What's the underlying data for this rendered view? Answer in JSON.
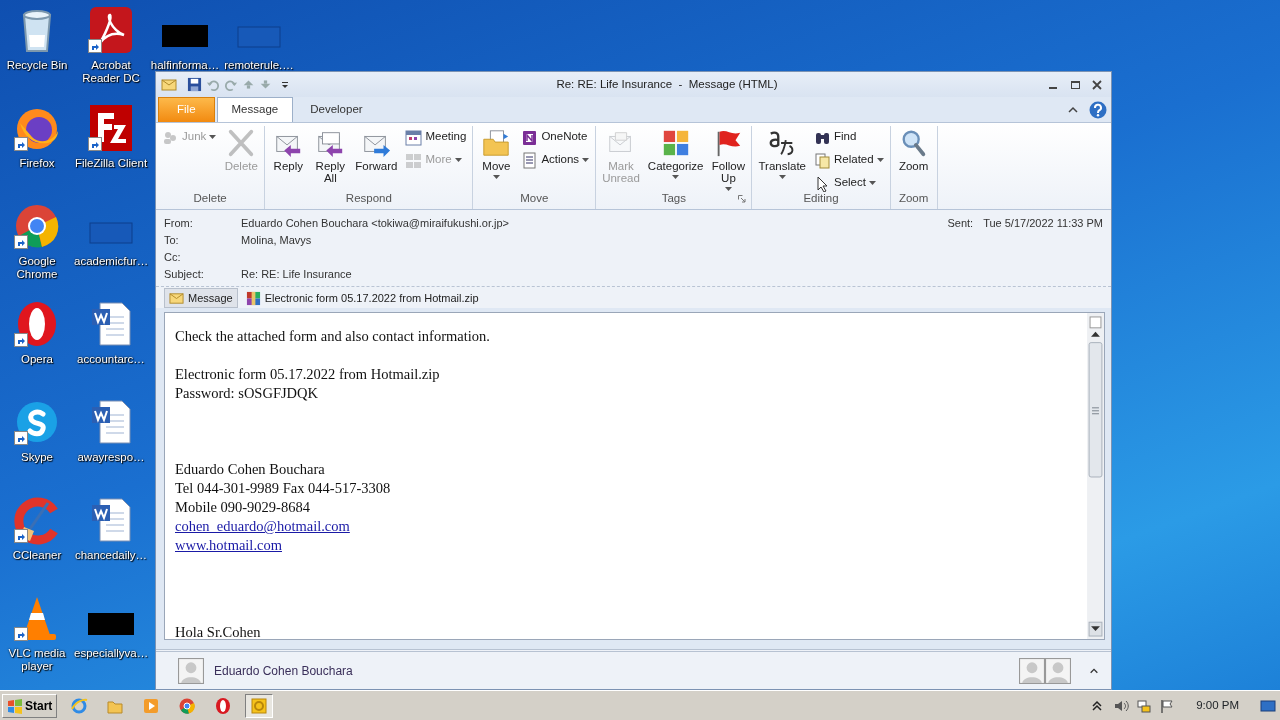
{
  "desktop": {
    "columns": [
      [
        {
          "label": "Recycle Bin",
          "shortcut": false
        },
        {
          "label": "Firefox",
          "shortcut": true
        },
        {
          "label": "Google Chrome",
          "shortcut": true
        },
        {
          "label": "Opera",
          "shortcut": true
        },
        {
          "label": "Skype",
          "shortcut": true
        },
        {
          "label": "CCleaner",
          "shortcut": true
        },
        {
          "label": "VLC media player",
          "shortcut": true
        }
      ],
      [
        {
          "label": "Acrobat Reader DC",
          "shortcut": true
        },
        {
          "label": "FileZilla Client",
          "shortcut": true
        },
        {
          "label": "academicfur…",
          "shortcut": false
        },
        {
          "label": "accountarc…",
          "shortcut": false
        },
        {
          "label": "awayrespo…",
          "shortcut": false
        },
        {
          "label": "chancedaily…",
          "shortcut": false
        },
        {
          "label": "especiallyva…",
          "shortcut": false
        }
      ],
      [
        {
          "label": "halfinforma…",
          "shortcut": false
        }
      ],
      [
        {
          "label": "remoterule.…",
          "shortcut": false
        }
      ]
    ]
  },
  "window": {
    "title": "Re: RE: Life Insurance  -  Message (HTML)",
    "tabs": [
      {
        "label": "File",
        "kind": "file",
        "selected": false
      },
      {
        "label": "Message",
        "kind": "tab",
        "selected": true
      },
      {
        "label": "Developer",
        "kind": "tab",
        "selected": false
      }
    ],
    "ribbon": {
      "groups": [
        {
          "label": "Delete",
          "launcher": false,
          "controls": [
            {
              "kind": "small",
              "label": "Junk",
              "disabled": true,
              "dropdown": true
            },
            {
              "kind": "large",
              "label": "Delete",
              "disabled": true,
              "dropdown": false
            }
          ]
        },
        {
          "label": "Respond",
          "launcher": false,
          "controls": [
            {
              "kind": "large",
              "label": "Reply",
              "disabled": false,
              "dropdown": false
            },
            {
              "kind": "large",
              "label": "Reply\nAll",
              "disabled": false,
              "dropdown": false
            },
            {
              "kind": "large",
              "label": "Forward",
              "disabled": false,
              "dropdown": false
            },
            {
              "kind": "small",
              "label": "Meeting",
              "disabled": false,
              "dropdown": false
            },
            {
              "kind": "small",
              "label": "More",
              "disabled": true,
              "dropdown": true
            }
          ]
        },
        {
          "label": "Move",
          "launcher": false,
          "controls": [
            {
              "kind": "large",
              "label": "Move",
              "disabled": false,
              "dropdown": true
            },
            {
              "kind": "small",
              "label": "OneNote",
              "disabled": false,
              "dropdown": false
            },
            {
              "kind": "small",
              "label": "Actions",
              "disabled": false,
              "dropdown": true
            }
          ]
        },
        {
          "label": "Tags",
          "launcher": true,
          "controls": [
            {
              "kind": "large",
              "label": "Mark\nUnread",
              "disabled": true,
              "dropdown": false
            },
            {
              "kind": "large",
              "label": "Categorize",
              "disabled": false,
              "dropdown": true
            },
            {
              "kind": "large",
              "label": "Follow\nUp",
              "disabled": false,
              "dropdown": true
            }
          ]
        },
        {
          "label": "Editing",
          "launcher": false,
          "controls": [
            {
              "kind": "large",
              "label": "Translate",
              "disabled": false,
              "dropdown": true
            },
            {
              "kind": "small",
              "label": "Find",
              "disabled": false,
              "dropdown": false
            },
            {
              "kind": "small",
              "label": "Related",
              "disabled": false,
              "dropdown": true
            },
            {
              "kind": "small",
              "label": "Select",
              "disabled": false,
              "dropdown": true
            }
          ]
        },
        {
          "label": "Zoom",
          "launcher": false,
          "controls": [
            {
              "kind": "large",
              "label": "Zoom",
              "disabled": false,
              "dropdown": false
            }
          ]
        }
      ]
    },
    "header": {
      "fields": [
        {
          "label": "From:",
          "value": "Eduardo Cohen Bouchara <tokiwa@miraifukushi.or.jp>"
        },
        {
          "label": "To:",
          "value": "Molina, Mavys"
        },
        {
          "label": "Cc:"
        },
        {
          "label": "Subject:",
          "value": "Re: RE: Life Insurance"
        }
      ],
      "sent": {
        "label": "Sent:",
        "value": "Tue 5/17/2022 11:33 PM"
      }
    },
    "attachments": [
      {
        "label": "Message",
        "selected": true
      },
      {
        "label": "Electronic form 05.17.2022 from Hotmail.zip",
        "selected": false
      }
    ],
    "body": {
      "blocks": [
        {
          "lines": [
            {
              "text": "Check the attached form and also contact information.",
              "link": false
            }
          ]
        },
        {
          "lines": [
            {
              "text": "Electronic form 05.17.2022 from Hotmail.zip",
              "link": false
            },
            {
              "text": "Password: sOSGFJDQK",
              "link": false
            }
          ]
        },
        {
          "lines": [
            {
              "text": "Eduardo Cohen Bouchara",
              "link": false
            },
            {
              "text": "Tel 044-301-9989 Fax 044-517-3308",
              "link": false
            },
            {
              "text": "Mobile 090-9029-8684",
              "link": false
            },
            {
              "text": "cohen_eduardo@hotmail.com",
              "link": true
            },
            {
              "text": "www.hotmail.com",
              "link": true
            }
          ]
        },
        {
          "lines": [
            {
              "text": "Hola Sr.Cohen",
              "link": false
            }
          ]
        }
      ]
    },
    "people_pane": {
      "name": "Eduardo Cohen Bouchara"
    }
  },
  "taskbar": {
    "start": "Start",
    "tasks": [
      {
        "selected": false
      },
      {
        "selected": false
      },
      {
        "selected": false
      },
      {
        "selected": false
      },
      {
        "selected": false
      },
      {
        "selected": true
      }
    ],
    "clock": "9:00 PM"
  }
}
